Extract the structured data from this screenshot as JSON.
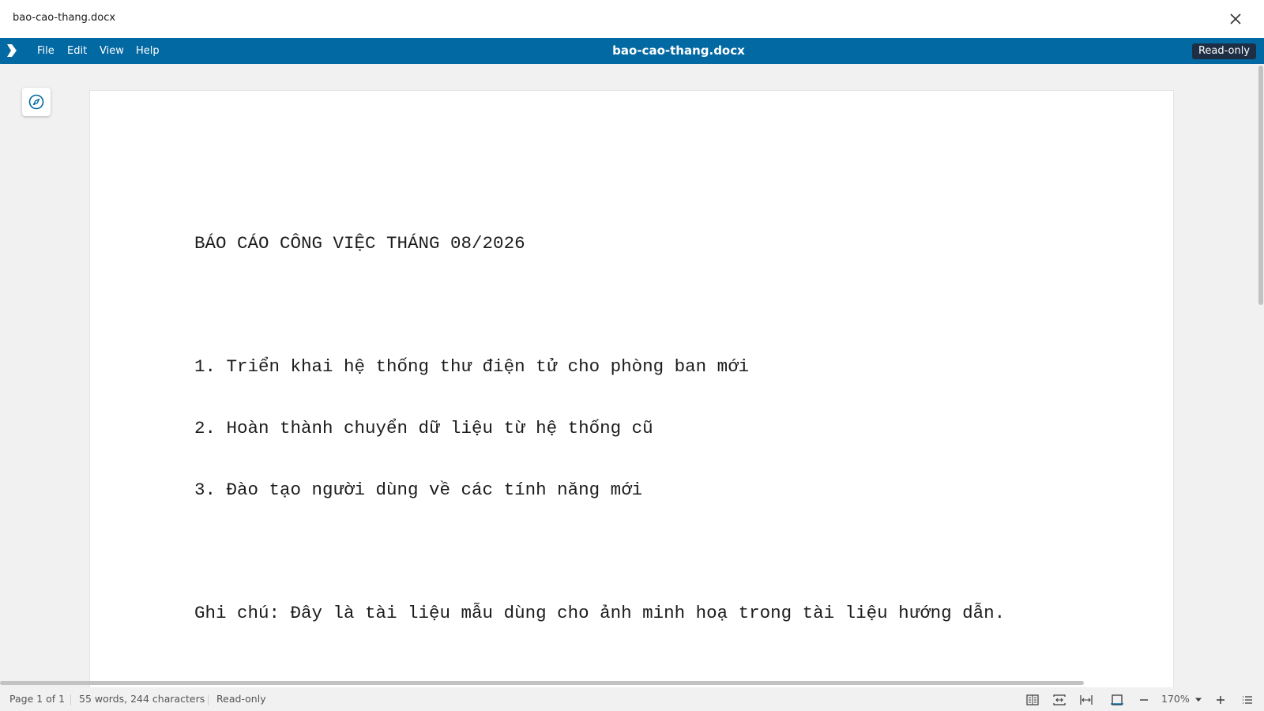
{
  "window": {
    "title": "bao-cao-thang.docx",
    "close_icon": "close-icon"
  },
  "menubar": {
    "logo_icon": "app-logo-icon",
    "menus": [
      "File",
      "Edit",
      "View",
      "Help"
    ],
    "doc_title": "bao-cao-thang.docx",
    "mode_badge": "Read-only",
    "accent_color": "#0369a3"
  },
  "sidebar": {
    "navigator_icon": "navigator-compass-icon"
  },
  "document": {
    "lines": [
      "BÁO CÁO CÔNG VIỆC THÁNG 08/2026",
      "",
      "1. Triển khai hệ thống thư điện tử cho phòng ban mới",
      "2. Hoàn thành chuyển dữ liệu từ hệ thống cũ",
      "3. Đào tạo người dùng về các tính năng mới",
      "",
      "Ghi chú: Đây là tài liệu mẫu dùng cho ảnh minh hoạ trong tài liệu hướng dẫn."
    ]
  },
  "statusbar": {
    "page_info": "Page 1 of 1",
    "word_count": "55 words, 244 characters",
    "mode": "Read-only",
    "zoom": "170%",
    "icons": [
      "single-page-view-icon",
      "multi-page-view-icon",
      "book-view-icon",
      "fit-page-icon",
      "zoom-out-icon",
      "zoom-dropdown-icon",
      "zoom-in-icon",
      "sidebar-menu-icon"
    ]
  }
}
